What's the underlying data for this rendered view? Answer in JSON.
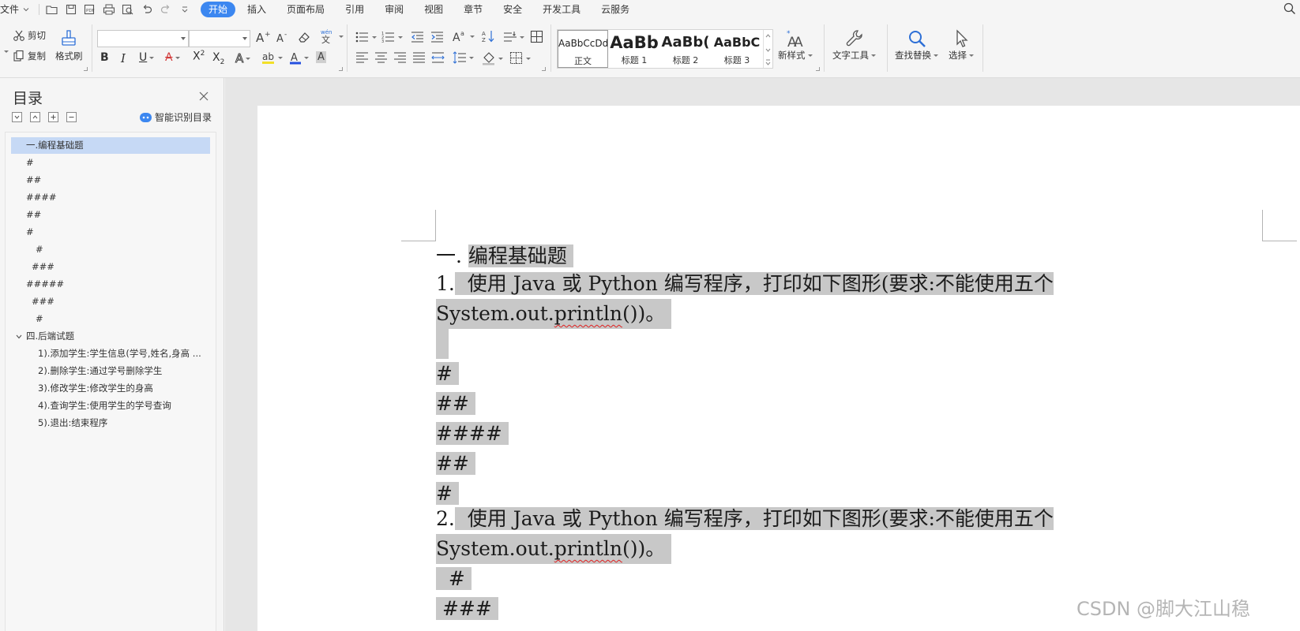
{
  "menubar": {
    "file_label": "文件",
    "tabs": [
      {
        "label": "开始",
        "active": true
      },
      {
        "label": "插入"
      },
      {
        "label": "页面布局"
      },
      {
        "label": "引用"
      },
      {
        "label": "审阅"
      },
      {
        "label": "视图"
      },
      {
        "label": "章节"
      },
      {
        "label": "安全"
      },
      {
        "label": "开发工具"
      },
      {
        "label": "云服务"
      }
    ],
    "accent_color": "#3c87f0"
  },
  "ribbon": {
    "cut_label": "剪切",
    "copy_label": "复制",
    "format_painter_label": "格式刷",
    "font_name_value": "",
    "font_size_value": "",
    "styles": [
      {
        "preview": "AaBbCcDd",
        "name": "正文",
        "selected": true
      },
      {
        "preview": "AaBb",
        "name": "标题 1"
      },
      {
        "preview": "AaBb(",
        "name": "标题 2"
      },
      {
        "preview": "AaBbC",
        "name": "标题 3"
      }
    ],
    "new_style_label": "新样式",
    "text_tools_label": "文字工具",
    "find_replace_label": "查找替换",
    "select_label": "选择"
  },
  "toc": {
    "title": "目录",
    "smart_label": "智能识别目录",
    "items": [
      {
        "text": "一.编程基础题",
        "selected": true,
        "indent": 0,
        "toggle": ""
      },
      {
        "text": "#",
        "indent": 0,
        "toggle": ""
      },
      {
        "text": "##",
        "indent": 0,
        "toggle": ""
      },
      {
        "text": "####",
        "indent": 0,
        "toggle": ""
      },
      {
        "text": "##",
        "indent": 0,
        "toggle": ""
      },
      {
        "text": "#",
        "indent": 0,
        "toggle": ""
      },
      {
        "text": "#",
        "indent": 2,
        "toggle": ""
      },
      {
        "text": "###",
        "indent": 1,
        "toggle": ""
      },
      {
        "text": "#####",
        "indent": 0,
        "toggle": ""
      },
      {
        "text": "###",
        "indent": 1,
        "toggle": ""
      },
      {
        "text": "#",
        "indent": 2,
        "toggle": ""
      },
      {
        "text": "四.后端试题",
        "indent": 0,
        "toggle": "expanded"
      },
      {
        "text": "1).添加学生:学生信息(学号,姓名,身高 ...",
        "indent": 3,
        "toggle": ""
      },
      {
        "text": "2).删除学生:通过学号删除学生",
        "indent": 3,
        "toggle": ""
      },
      {
        "text": "3).修改学生:修改学生的身高",
        "indent": 3,
        "toggle": ""
      },
      {
        "text": "4).查询学生:使用学生的学号查询",
        "indent": 3,
        "toggle": ""
      },
      {
        "text": "5).退出:结束程序",
        "indent": 3,
        "toggle": ""
      }
    ]
  },
  "document": {
    "heading_num": "一.",
    "heading_text": "编程基础题",
    "q1_num": "1.",
    "q1_text": "使用 Java 或 Python 编写程序，打印如下图形(要求:不能使用五个",
    "q1_cont_a": "System.out.",
    "q1_cont_b": "println",
    "q1_cont_c": "())。",
    "pattern1": [
      "#",
      "##",
      "####",
      "##",
      "#"
    ],
    "q2_num": "2.",
    "q2_text": "使用 Java 或 Python 编写程序，打印如下图形(要求:不能使用五个",
    "q2_cont_a": "System.out.",
    "q2_cont_b": "println",
    "q2_cont_c": "())。",
    "pattern2": [
      "  #",
      " ###"
    ]
  },
  "watermark": "CSDN @脚大江山稳"
}
